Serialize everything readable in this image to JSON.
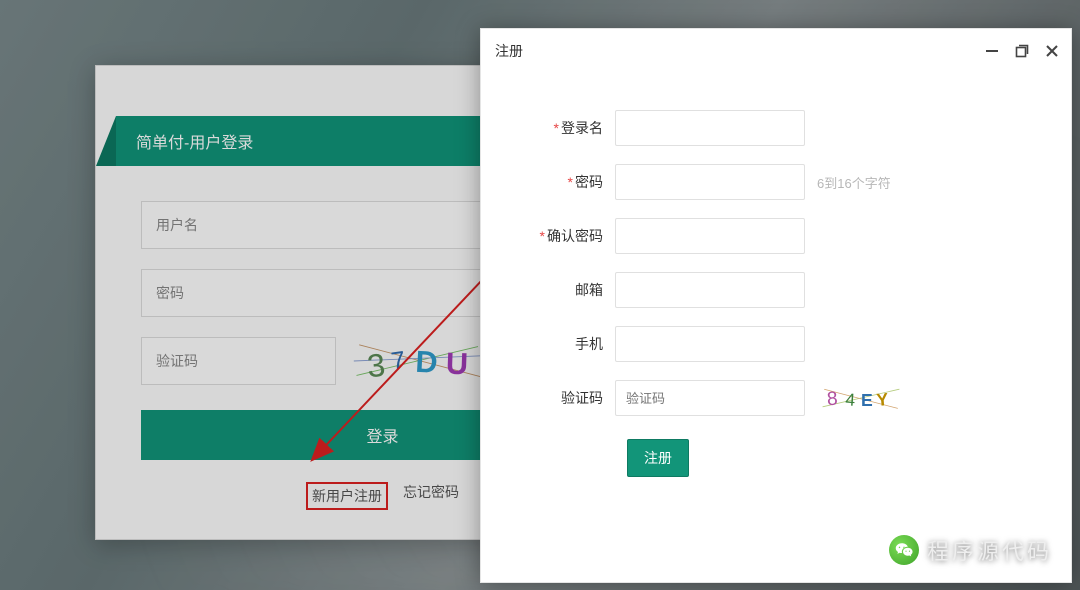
{
  "login": {
    "header_title": "简单付-用户登录",
    "username_placeholder": "用户名",
    "password_placeholder": "密码",
    "captcha_placeholder": "验证码",
    "captcha_text": "37DU",
    "submit_label": "登录",
    "register_link": "新用户注册",
    "forgot_link": "忘记密码"
  },
  "modal": {
    "title": "注册",
    "fields": {
      "login_name": {
        "label": "登录名",
        "required": true
      },
      "password": {
        "label": "密码",
        "required": true,
        "hint": "6到16个字符"
      },
      "confirm_password": {
        "label": "确认密码",
        "required": true
      },
      "email": {
        "label": "邮箱",
        "required": false
      },
      "phone": {
        "label": "手机",
        "required": false
      },
      "captcha": {
        "label": "验证码",
        "required": false,
        "placeholder": "验证码",
        "captcha_text": "84EY"
      }
    },
    "submit_label": "注册"
  },
  "watermark": {
    "text": "程序源代码"
  },
  "colors": {
    "teal": "#119579",
    "teal_dark": "#0c7a63",
    "error_red": "#e64545"
  }
}
